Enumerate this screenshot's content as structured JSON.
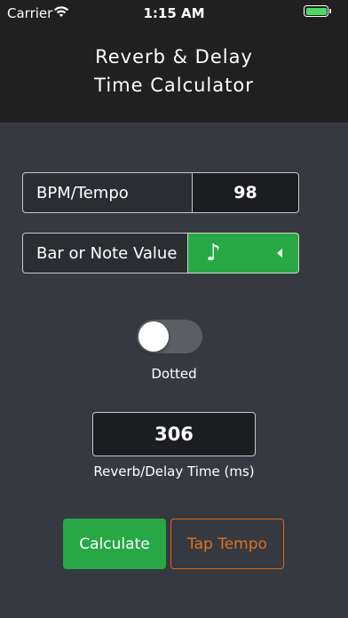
{
  "status_bar": {
    "carrier": "Carrier",
    "time": "1:15 AM",
    "battery_color": "#4cd964"
  },
  "header": {
    "title_line1": "Reverb & Delay",
    "title_line2": "Time Calculator"
  },
  "form": {
    "bpm_label": "BPM/Tempo",
    "bpm_value": "98",
    "note_label": "Bar or Note Value",
    "note_value": "♪",
    "note_selector_color": "#28a745"
  },
  "dotted": {
    "label": "Dotted",
    "on": false
  },
  "result": {
    "value": "306",
    "label": "Reverb/Delay Time (ms)"
  },
  "buttons": {
    "calculate": "Calculate",
    "tap_tempo": "Tap Tempo",
    "calculate_color": "#28a745",
    "tap_tempo_color": "#e07020"
  },
  "icons": {
    "wifi": "wifi-icon",
    "battery": "battery-icon",
    "caret": "caret-left-icon",
    "note": "eighth-note-icon"
  }
}
